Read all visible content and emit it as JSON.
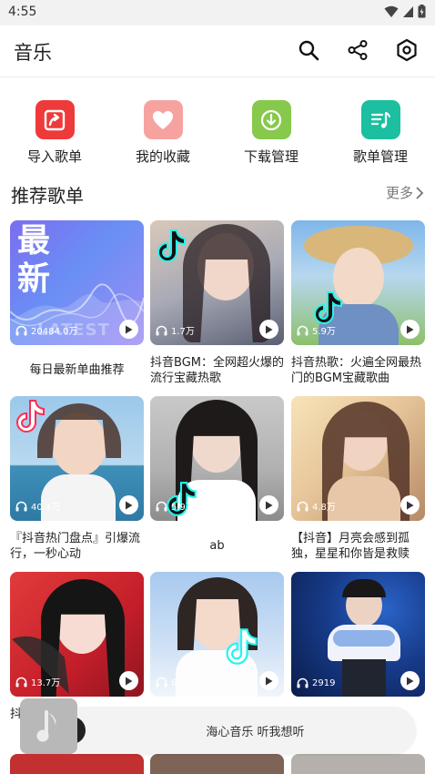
{
  "status": {
    "time": "4:55"
  },
  "header": {
    "title": "音乐",
    "icons": [
      "search-icon",
      "share-icon",
      "settings-icon"
    ]
  },
  "quick_actions": [
    {
      "label": "导入歌单",
      "icon": "import-icon",
      "color": "#ee3a3a"
    },
    {
      "label": "我的收藏",
      "icon": "heart-icon",
      "color": "#f6a3a0"
    },
    {
      "label": "下载管理",
      "icon": "download-icon",
      "color": "#86c94d"
    },
    {
      "label": "歌单管理",
      "icon": "playlist-icon",
      "color": "#1cbfa0"
    }
  ],
  "section": {
    "title": "推荐歌单",
    "more": "更多"
  },
  "playlists": [
    {
      "cover_text": "最新",
      "cover_text2": "LATEST",
      "plays": "20484.0万",
      "title": "每日最新单曲推荐"
    },
    {
      "plays": "1.7万",
      "title": "抖音BGM：全网超火爆的流行宝藏热歌"
    },
    {
      "plays": "5.9万",
      "title": "抖音热歌：火遍全网最热门的BGM宝藏歌曲"
    },
    {
      "plays": "40.4万",
      "title": "『抖音热门盘点』引爆流行，一秒心动"
    },
    {
      "plays": "5.9万",
      "title": "ab"
    },
    {
      "plays": "4.8万",
      "title": "【抖音】月亮会感到孤独，星星和你皆是救赎"
    },
    {
      "plays": "13.7万",
      "title": "抖"
    },
    {
      "plays": "67.0万",
      "title": ""
    },
    {
      "plays": "2919",
      "title": ""
    }
  ],
  "player": {
    "text": "海心音乐 听我想听",
    "icon": "music-note-icon"
  }
}
